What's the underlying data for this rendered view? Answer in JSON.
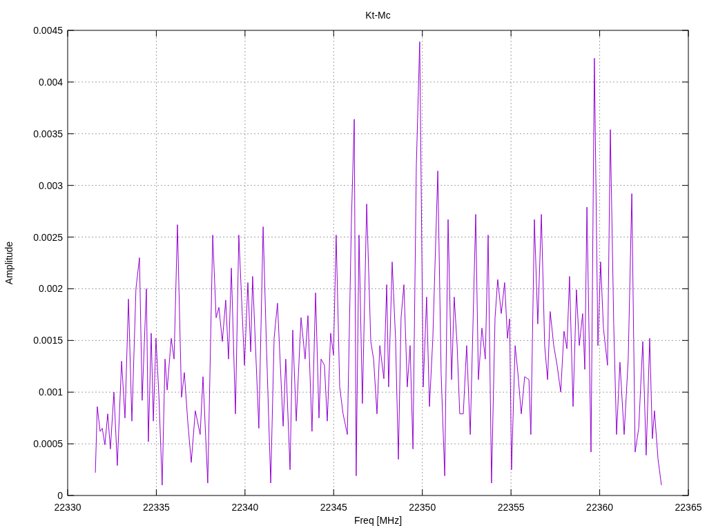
{
  "chart_data": {
    "type": "line",
    "title": "Kt-Mc",
    "xlabel": "Freq [MHz]",
    "ylabel": "Amplitude",
    "grid": true,
    "xlim": [
      22330,
      22365
    ],
    "ylim": [
      0,
      0.0045
    ],
    "xticks": [
      22330,
      22335,
      22340,
      22345,
      22350,
      22355,
      22360,
      22365
    ],
    "yticks": [
      0,
      0.0005,
      0.001,
      0.0015,
      0.002,
      0.0025,
      0.003,
      0.0035,
      0.004,
      0.0045
    ],
    "x": [
      22331.56,
      22331.67,
      22331.83,
      22331.95,
      22332.1,
      22332.26,
      22332.41,
      22332.61,
      22332.8,
      22333.04,
      22333.23,
      22333.43,
      22333.62,
      22333.85,
      22334.05,
      22334.2,
      22334.44,
      22334.55,
      22334.71,
      22334.83,
      22334.98,
      22335.14,
      22335.33,
      22335.49,
      22335.61,
      22335.84,
      22336.0,
      22336.19,
      22336.42,
      22336.58,
      22336.77,
      22336.97,
      22337.2,
      22337.47,
      22337.63,
      22337.9,
      22338.18,
      22338.37,
      22338.53,
      22338.72,
      22338.91,
      22339.07,
      22339.23,
      22339.46,
      22339.65,
      22339.97,
      22340.16,
      22340.32,
      22340.43,
      22340.78,
      22341.02,
      22341.21,
      22341.45,
      22341.64,
      22341.83,
      22342.15,
      22342.3,
      22342.54,
      22342.69,
      22342.89,
      22343.16,
      22343.39,
      22343.55,
      22343.78,
      22343.98,
      22344.17,
      22344.29,
      22344.48,
      22344.64,
      22344.83,
      22344.99,
      22345.14,
      22345.34,
      22345.53,
      22345.77,
      22346.0,
      22346.16,
      22346.27,
      22346.43,
      22346.62,
      22346.86,
      22347.09,
      22347.25,
      22347.44,
      22347.6,
      22347.83,
      22347.99,
      22348.1,
      22348.3,
      22348.49,
      22348.65,
      22348.8,
      22348.96,
      22349.15,
      22349.31,
      22349.47,
      22349.66,
      22349.85,
      22350.05,
      22350.24,
      22350.4,
      22350.59,
      22350.87,
      22351.06,
      22351.26,
      22351.45,
      22351.65,
      22351.8,
      22351.96,
      22352.11,
      22352.31,
      22352.5,
      22352.7,
      22353.01,
      22353.16,
      22353.36,
      22353.55,
      22353.71,
      22353.9,
      22354.1,
      22354.25,
      22354.45,
      22354.64,
      22354.8,
      22354.92,
      22355.03,
      22355.23,
      22355.38,
      22355.58,
      22355.77,
      22356.01,
      22356.12,
      22356.32,
      22356.51,
      22356.71,
      22356.9,
      22357.06,
      22357.21,
      22357.41,
      22357.6,
      22357.8,
      22357.99,
      22358.15,
      22358.3,
      22358.5,
      22358.69,
      22358.85,
      22359.04,
      22359.16,
      22359.28,
      22359.51,
      22359.7,
      22359.9,
      22360.05,
      22360.21,
      22360.44,
      22360.6,
      22360.79,
      22360.95,
      22361.14,
      22361.38,
      22361.61,
      22361.81,
      22362.0,
      22362.2,
      22362.43,
      22362.62,
      22362.82,
      22362.97,
      22363.09,
      22363.29,
      22363.48
    ],
    "series": [
      {
        "color": "#9400d3",
        "values": [
          0.00022,
          0.00086,
          0.00062,
          0.00065,
          0.00049,
          0.00079,
          0.00045,
          0.001,
          0.00029,
          0.0013,
          0.00075,
          0.0019,
          0.00072,
          0.002,
          0.0023,
          0.00092,
          0.002,
          0.00052,
          0.00157,
          0.00072,
          0.00152,
          0.00099,
          0.0001,
          0.00132,
          0.00102,
          0.00152,
          0.00132,
          0.00262,
          0.00095,
          0.00119,
          0.00072,
          0.00032,
          0.00082,
          0.00059,
          0.00115,
          0.00012,
          0.00252,
          0.00172,
          0.00182,
          0.00149,
          0.00189,
          0.00132,
          0.0022,
          0.00079,
          0.00252,
          0.00126,
          0.00206,
          0.00139,
          0.00212,
          0.00065,
          0.0026,
          0.00145,
          0.00012,
          0.00152,
          0.00186,
          0.00067,
          0.00132,
          0.00025,
          0.0016,
          0.00072,
          0.00172,
          0.00132,
          0.00174,
          0.00062,
          0.00196,
          0.00075,
          0.00132,
          0.00126,
          0.00072,
          0.00157,
          0.00136,
          0.00252,
          0.00105,
          0.00079,
          0.00059,
          0.00267,
          0.00364,
          0.00019,
          0.00252,
          0.00089,
          0.00282,
          0.00149,
          0.00132,
          0.00079,
          0.00145,
          0.00113,
          0.00204,
          0.00105,
          0.00226,
          0.00152,
          0.00035,
          0.00172,
          0.00204,
          0.00105,
          0.00145,
          0.00045,
          0.00319,
          0.00439,
          0.00105,
          0.00192,
          0.00086,
          0.00152,
          0.00314,
          0.00119,
          0.00019,
          0.00267,
          0.00112,
          0.00192,
          0.00145,
          0.00079,
          0.00079,
          0.00145,
          0.00059,
          0.00272,
          0.00112,
          0.00162,
          0.00132,
          0.00252,
          0.00012,
          0.00172,
          0.00209,
          0.00176,
          0.00206,
          0.00152,
          0.00171,
          0.00025,
          0.00145,
          0.0012,
          0.00079,
          0.00115,
          0.00112,
          0.00059,
          0.00267,
          0.00166,
          0.00272,
          0.00145,
          0.00112,
          0.00178,
          0.00145,
          0.00126,
          0.001,
          0.00159,
          0.00142,
          0.00212,
          0.00086,
          0.00199,
          0.00145,
          0.00176,
          0.00122,
          0.00279,
          0.00042,
          0.00423,
          0.00145,
          0.00226,
          0.00162,
          0.00126,
          0.00354,
          0.00166,
          0.00059,
          0.00129,
          0.00059,
          0.00132,
          0.00292,
          0.00042,
          0.00065,
          0.00149,
          0.00039,
          0.00152,
          0.00055,
          0.00082,
          0.00035,
          0.0001
        ]
      }
    ]
  }
}
